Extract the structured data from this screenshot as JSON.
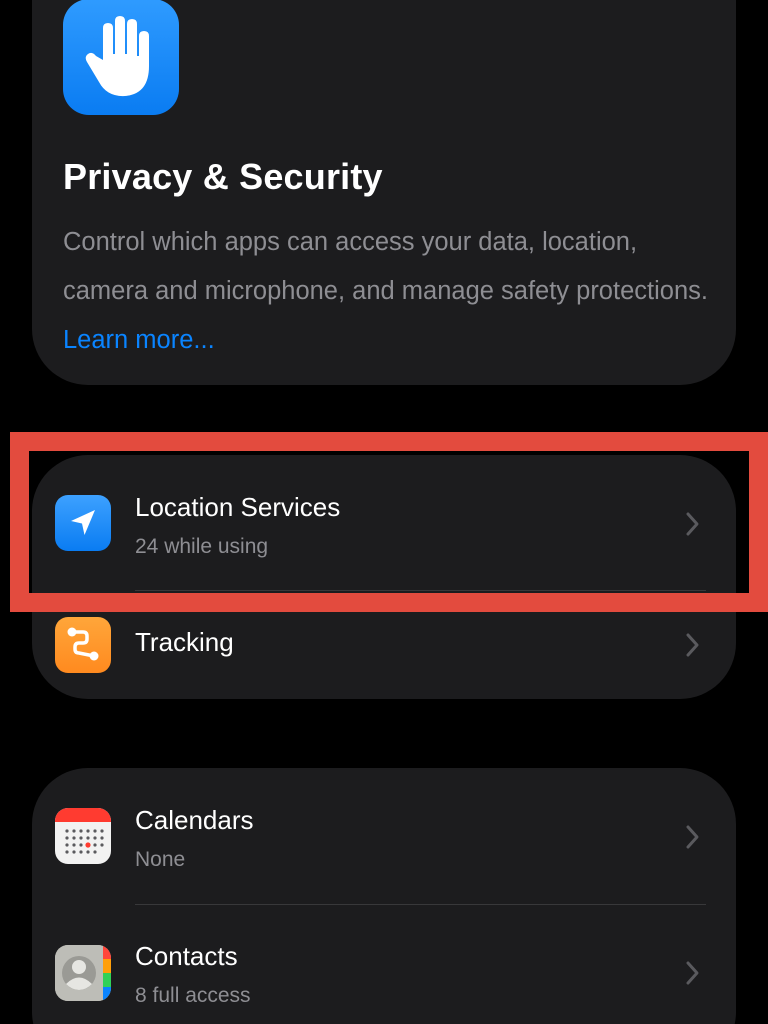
{
  "header": {
    "icon": "raised-hand-icon",
    "title": "Privacy & Security",
    "description": "Control which apps can access your data, location, camera and microphone, and manage safety protections.",
    "learn_more": "Learn more..."
  },
  "group1": {
    "items": [
      {
        "title": "Location Services",
        "subtitle": "24 while using",
        "icon": "location-arrow-icon",
        "icon_color": "#0a84ff"
      },
      {
        "title": "Tracking",
        "icon": "tracking-icon",
        "icon_color": "#ff9f0a"
      }
    ]
  },
  "group2": {
    "items": [
      {
        "title": "Calendars",
        "subtitle": "None",
        "icon": "calendar-icon"
      },
      {
        "title": "Contacts",
        "subtitle": "8 full access",
        "icon": "contacts-icon"
      }
    ]
  },
  "colors": {
    "background": "#000000",
    "card": "#1c1c1e",
    "link": "#0a84ff",
    "highlight": "#e34b3e"
  }
}
